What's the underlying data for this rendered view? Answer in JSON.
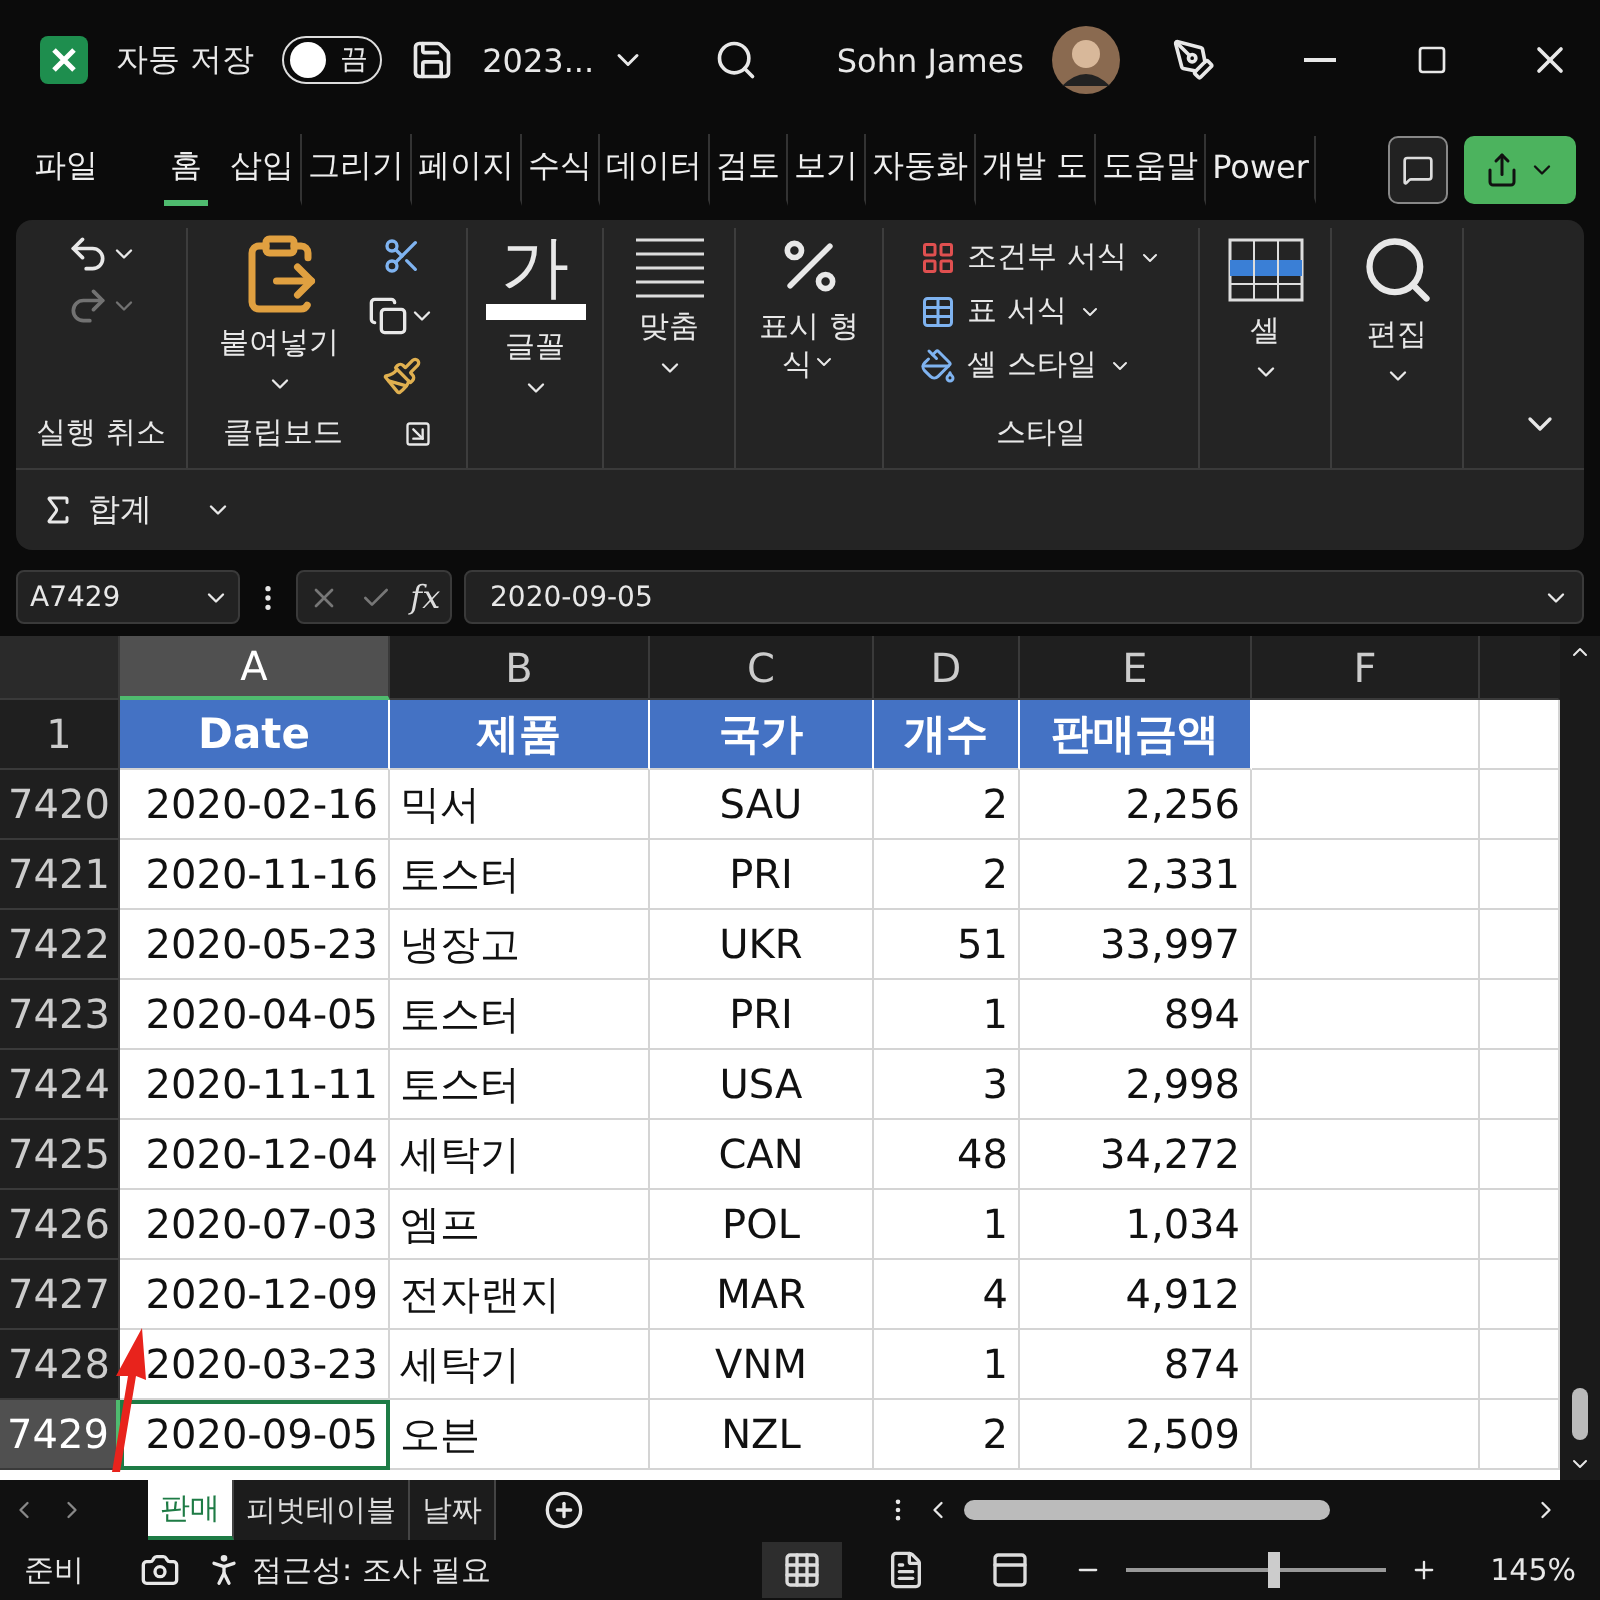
{
  "title_bar": {
    "autosave_label": "자동 저장",
    "autosave": {
      "on": false,
      "label": "끔"
    },
    "file_name": "2023...",
    "user_name": "Sohn James"
  },
  "menu_tabs": [
    {
      "label": "파일",
      "selected": false
    },
    {
      "label": "홈",
      "selected": true
    },
    {
      "label": "삽입",
      "selected": false
    },
    {
      "label": "그리기",
      "selected": false
    },
    {
      "label": "페이지",
      "selected": false
    },
    {
      "label": "수식",
      "selected": false
    },
    {
      "label": "데이터",
      "selected": false
    },
    {
      "label": "검토",
      "selected": false
    },
    {
      "label": "보기",
      "selected": false
    },
    {
      "label": "자동화",
      "selected": false
    },
    {
      "label": "개발 도",
      "selected": false
    },
    {
      "label": "도움말",
      "selected": false
    },
    {
      "label": "Power",
      "selected": false
    }
  ],
  "ribbon": {
    "groups": [
      {
        "kind": "undo",
        "label": "실행 취소"
      },
      {
        "kind": "clipboard",
        "paste": "붙여넣기",
        "label": "클립보드"
      },
      {
        "kind": "font",
        "glyph": "가",
        "button": "글꼴"
      },
      {
        "kind": "alignment",
        "button": "맞춤"
      },
      {
        "kind": "number",
        "button": "표시 형식"
      },
      {
        "kind": "styles",
        "items": [
          "조건부 서식",
          "표 서식",
          "셀 스타일"
        ],
        "label": "스타일"
      },
      {
        "kind": "cells",
        "button": "셀"
      },
      {
        "kind": "editing",
        "button": "편집"
      }
    ],
    "sum": "합계"
  },
  "formula_bar": {
    "name_box": "A7429",
    "fx": "fx",
    "value": "2020-09-05"
  },
  "sheet": {
    "columns": [
      {
        "label": "A",
        "selected": true
      },
      {
        "label": "B",
        "selected": false
      },
      {
        "label": "C",
        "selected": false
      },
      {
        "label": "D",
        "selected": false
      },
      {
        "label": "E",
        "selected": false
      },
      {
        "label": "F",
        "selected": false
      }
    ],
    "header_row": "1",
    "headers": [
      "Date",
      "제품",
      "국가",
      "개수",
      "판매금액"
    ],
    "rows": [
      {
        "num": "7420",
        "selected": false,
        "cells": [
          "2020-02-16",
          "믹서",
          "SAU",
          "2",
          "2,256"
        ]
      },
      {
        "num": "7421",
        "selected": false,
        "cells": [
          "2020-11-16",
          "토스터",
          "PRI",
          "2",
          "2,331"
        ]
      },
      {
        "num": "7422",
        "selected": false,
        "cells": [
          "2020-05-23",
          "냉장고",
          "UKR",
          "51",
          "33,997"
        ]
      },
      {
        "num": "7423",
        "selected": false,
        "cells": [
          "2020-04-05",
          "토스터",
          "PRI",
          "1",
          "894"
        ]
      },
      {
        "num": "7424",
        "selected": false,
        "cells": [
          "2020-11-11",
          "토스터",
          "USA",
          "3",
          "2,998"
        ]
      },
      {
        "num": "7425",
        "selected": false,
        "cells": [
          "2020-12-04",
          "세탁기",
          "CAN",
          "48",
          "34,272"
        ]
      },
      {
        "num": "7426",
        "selected": false,
        "cells": [
          "2020-07-03",
          "엠프",
          "POL",
          "1",
          "1,034"
        ]
      },
      {
        "num": "7427",
        "selected": false,
        "cells": [
          "2020-12-09",
          "전자랜지",
          "MAR",
          "4",
          "4,912"
        ]
      },
      {
        "num": "7428",
        "selected": false,
        "cells": [
          "2020-03-23",
          "세탁기",
          "VNM",
          "1",
          "874"
        ]
      },
      {
        "num": "7429",
        "selected": true,
        "cells": [
          "2020-09-05",
          "오븐",
          "NZL",
          "2",
          "2,509"
        ]
      }
    ]
  },
  "sheet_tabs": [
    {
      "label": "판매",
      "selected": true
    },
    {
      "label": "피벗테이블",
      "selected": false
    },
    {
      "label": "날짜",
      "selected": false
    }
  ],
  "status_bar": {
    "ready": "준비",
    "accessibility": "접근성: 조사 필요",
    "zoom": {
      "level": 0.57,
      "label": "145%"
    }
  }
}
